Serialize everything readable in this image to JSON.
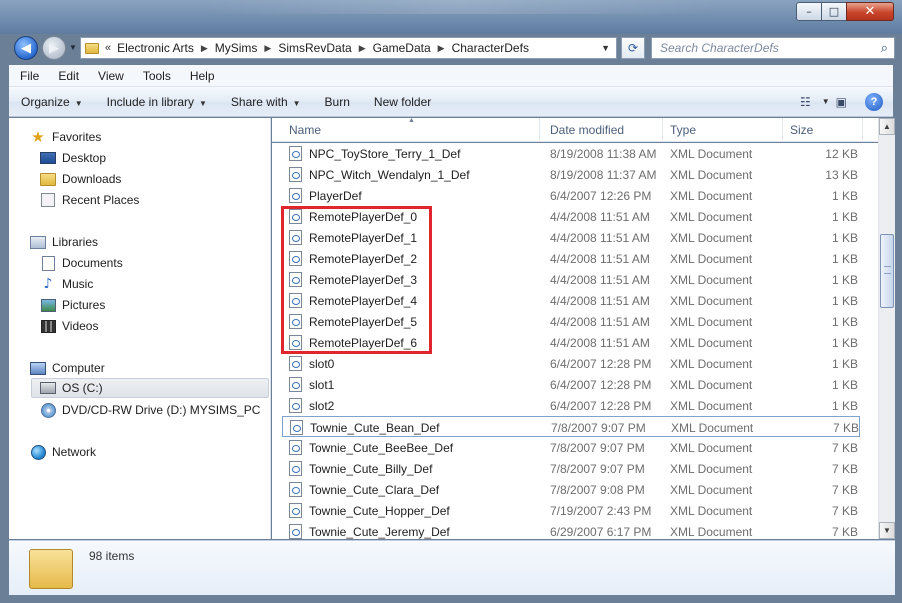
{
  "window": {
    "minimize_glyph": "–",
    "maximize_glyph": "□",
    "close_glyph": "✕"
  },
  "address": {
    "chevron": "«",
    "crumbs": [
      "Electronic Arts",
      "MySims",
      "SimsRevData",
      "GameData",
      "CharacterDefs"
    ],
    "separator": "▶",
    "dropdown_glyph": "▼"
  },
  "search": {
    "placeholder": "Search CharacterDefs",
    "icon": "search-icon"
  },
  "menubar": [
    "File",
    "Edit",
    "View",
    "Tools",
    "Help"
  ],
  "toolbar": {
    "organize": "Organize",
    "include_in_library": "Include in library",
    "share_with": "Share with",
    "burn": "Burn",
    "new_folder": "New folder"
  },
  "navigation": {
    "favorites": {
      "label": "Favorites",
      "items": [
        "Desktop",
        "Downloads",
        "Recent Places"
      ]
    },
    "libraries": {
      "label": "Libraries",
      "items": [
        "Documents",
        "Music",
        "Pictures",
        "Videos"
      ]
    },
    "computer": {
      "label": "Computer",
      "items": [
        "OS (C:)",
        "DVD/CD-RW Drive (D:) MYSIMS_PC"
      ]
    },
    "network": {
      "label": "Network"
    }
  },
  "columns": {
    "name": "Name",
    "date_modified": "Date modified",
    "type": "Type",
    "size": "Size"
  },
  "files": [
    {
      "name": "NPC_ToyStore_Terry_1_Def",
      "date": "8/19/2008 11:38 AM",
      "type": "XML Document",
      "size": "12 KB"
    },
    {
      "name": "NPC_Witch_Wendalyn_1_Def",
      "date": "8/19/2008 11:37 AM",
      "type": "XML Document",
      "size": "13 KB"
    },
    {
      "name": "PlayerDef",
      "date": "6/4/2007 12:26 PM",
      "type": "XML Document",
      "size": "1 KB"
    },
    {
      "name": "RemotePlayerDef_0",
      "date": "4/4/2008 11:51 AM",
      "type": "XML Document",
      "size": "1 KB"
    },
    {
      "name": "RemotePlayerDef_1",
      "date": "4/4/2008 11:51 AM",
      "type": "XML Document",
      "size": "1 KB"
    },
    {
      "name": "RemotePlayerDef_2",
      "date": "4/4/2008 11:51 AM",
      "type": "XML Document",
      "size": "1 KB"
    },
    {
      "name": "RemotePlayerDef_3",
      "date": "4/4/2008 11:51 AM",
      "type": "XML Document",
      "size": "1 KB"
    },
    {
      "name": "RemotePlayerDef_4",
      "date": "4/4/2008 11:51 AM",
      "type": "XML Document",
      "size": "1 KB"
    },
    {
      "name": "RemotePlayerDef_5",
      "date": "4/4/2008 11:51 AM",
      "type": "XML Document",
      "size": "1 KB"
    },
    {
      "name": "RemotePlayerDef_6",
      "date": "4/4/2008 11:51 AM",
      "type": "XML Document",
      "size": "1 KB"
    },
    {
      "name": "slot0",
      "date": "6/4/2007 12:28 PM",
      "type": "XML Document",
      "size": "1 KB"
    },
    {
      "name": "slot1",
      "date": "6/4/2007 12:28 PM",
      "type": "XML Document",
      "size": "1 KB"
    },
    {
      "name": "slot2",
      "date": "6/4/2007 12:28 PM",
      "type": "XML Document",
      "size": "1 KB"
    },
    {
      "name": "Townie_Cute_Bean_Def",
      "date": "7/8/2007 9:07 PM",
      "type": "XML Document",
      "size": "7 KB"
    },
    {
      "name": "Townie_Cute_BeeBee_Def",
      "date": "7/8/2007 9:07 PM",
      "type": "XML Document",
      "size": "7 KB"
    },
    {
      "name": "Townie_Cute_Billy_Def",
      "date": "7/8/2007 9:07 PM",
      "type": "XML Document",
      "size": "7 KB"
    },
    {
      "name": "Townie_Cute_Clara_Def",
      "date": "7/8/2007 9:08 PM",
      "type": "XML Document",
      "size": "7 KB"
    },
    {
      "name": "Townie_Cute_Hopper_Def",
      "date": "7/19/2007 2:43 PM",
      "type": "XML Document",
      "size": "7 KB"
    },
    {
      "name": "Townie_Cute_Jeremy_Def",
      "date": "6/29/2007 6:17 PM",
      "type": "XML Document",
      "size": "7 KB"
    }
  ],
  "status": {
    "item_count": "98 items"
  },
  "colors": {
    "highlight_border": "#e0252c",
    "focus_border": "#7da2ce",
    "accent": "#2a6ad0"
  }
}
